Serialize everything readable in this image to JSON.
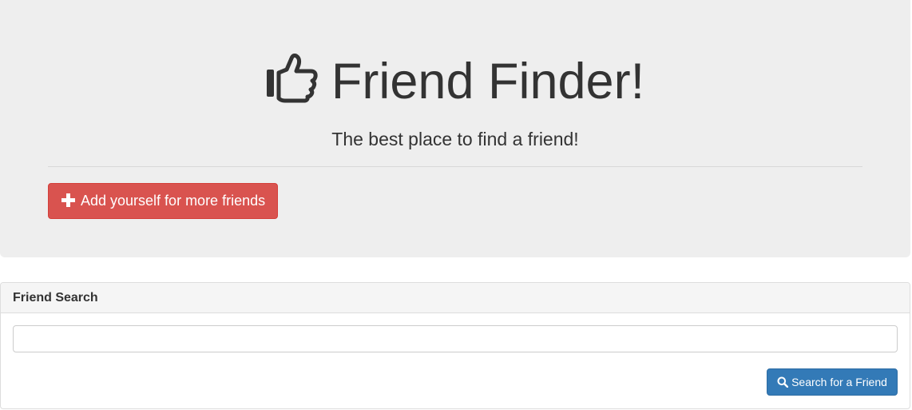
{
  "jumbotron": {
    "icon": "thumbs-up-icon",
    "title": "Friend Finder!",
    "subtitle": "The best place to find a friend!",
    "add_button": {
      "icon": "plus-icon",
      "label": "Add yourself for more friends"
    }
  },
  "search_panel": {
    "heading": "Friend Search",
    "input_value": "",
    "search_button": {
      "icon": "search-icon",
      "label": "Search for a Friend"
    }
  },
  "colors": {
    "jumbotron_bg": "#eeeeee",
    "danger": "#d9534f",
    "primary": "#337ab7",
    "text": "#333333"
  }
}
